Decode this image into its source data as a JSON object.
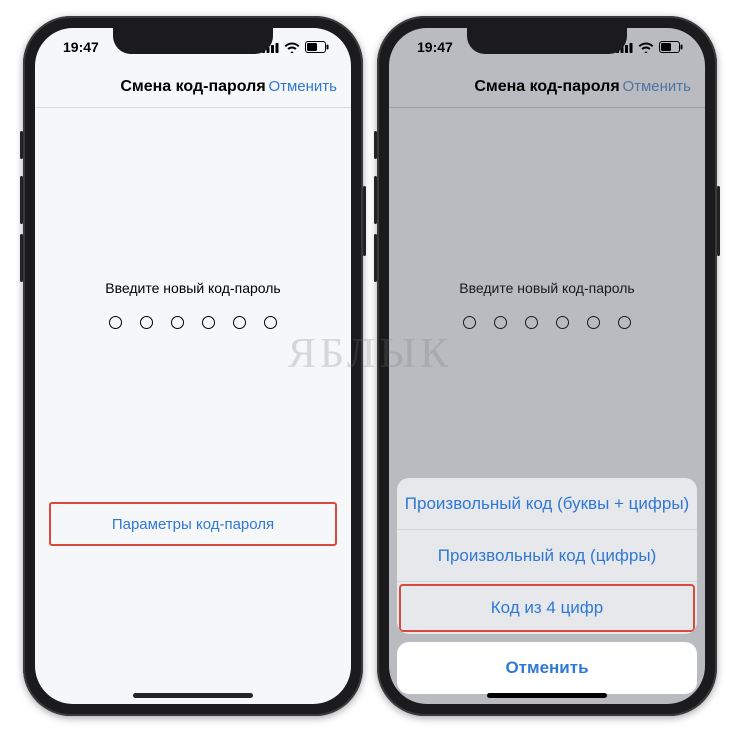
{
  "status": {
    "time": "19:47"
  },
  "nav": {
    "title": "Смена код-пароля",
    "cancel": "Отменить"
  },
  "prompt": "Введите новый код-пароль",
  "params_button": "Параметры код-пароля",
  "sheet": {
    "options": [
      "Произвольный код (буквы + цифры)",
      "Произвольный код (цифры)",
      "Код из 4 цифр"
    ],
    "cancel": "Отменить"
  },
  "watermark": "ЯБЛЫК"
}
